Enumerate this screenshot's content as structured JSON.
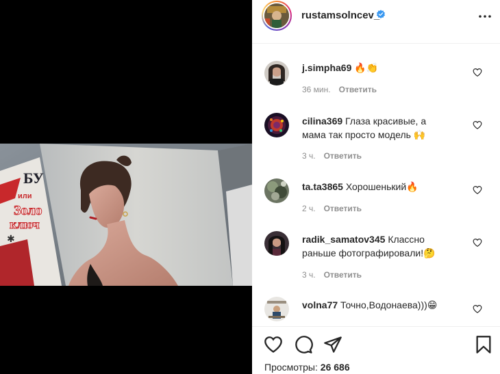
{
  "post": {
    "author": "rustamsolncev_",
    "verified": true
  },
  "comments": [
    {
      "user": "j.simpha69",
      "text": "🔥👏",
      "time": "36 мин.",
      "reply": "Ответить"
    },
    {
      "user": "cilina369",
      "text": "Глаза красивые, а мама так просто модель 🙌",
      "time": "3 ч.",
      "reply": "Ответить"
    },
    {
      "user": "ta.ta3865",
      "text": "Хорошенький🔥",
      "time": "2 ч.",
      "reply": "Ответить"
    },
    {
      "user": "radik_samatov345",
      "text": "Классно раньше фотографировали!🤔",
      "time": "3 ч.",
      "reply": "Ответить"
    },
    {
      "user": "volna77",
      "text": "Точно,Водонаева)))😁",
      "time": "",
      "reply": ""
    }
  ],
  "footer": {
    "views_label": "Просмотры:",
    "views_count": "26 686"
  },
  "media": {
    "book_text_1": "БУ",
    "book_text_2": "или",
    "book_text_3": "Золо",
    "book_text_4": "ключ"
  },
  "colors": {
    "verified": "#3897f0",
    "text": "#262626",
    "meta": "#8e8e8e",
    "border": "#efefef"
  },
  "icons": {
    "more": "more-horizontal-icon",
    "like": "heart-icon",
    "comment": "comment-icon",
    "share": "paper-plane-icon",
    "save": "bookmark-icon"
  }
}
